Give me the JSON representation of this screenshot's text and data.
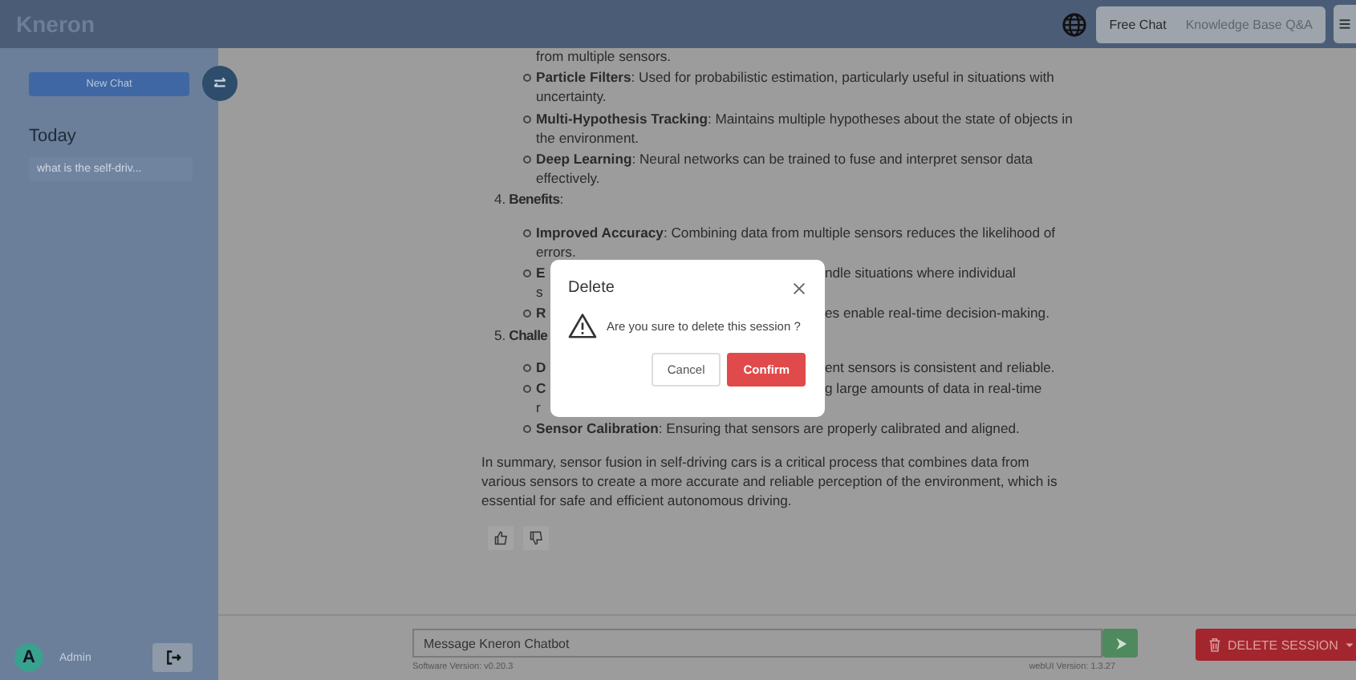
{
  "header": {
    "logo": "Kneron",
    "tabs": [
      {
        "label": "Free Chat",
        "selected": true
      },
      {
        "label": "Knowledge Base Q&A",
        "selected": false
      }
    ]
  },
  "sidebar": {
    "new_chat": "New Chat",
    "section": "Today",
    "items": [
      {
        "label": "what is the self-driv...",
        "selected": false
      }
    ],
    "user": {
      "initial": "A",
      "name": "Admin"
    }
  },
  "message": {
    "blocks": [
      {
        "kind": "text",
        "text": "from multiple sensors."
      },
      {
        "kind": "bullet",
        "text": "**Particle Filters**: Used for probabilistic estimation, particularly useful in situations with uncertainty."
      },
      {
        "kind": "bullet",
        "text": "**Multi-Hypothesis Tracking**: Maintains multiple hypotheses about the state of objects in the environment."
      },
      {
        "kind": "bullet",
        "text": "**Deep Learning**: Neural networks can be trained to fuse and interpret sensor data effectively."
      },
      {
        "kind": "heading",
        "number": "4.",
        "text": "**Benefits**:"
      },
      {
        "kind": "bullet",
        "text": "**Improved Accuracy**: Combining data from multiple sensors reduces the likelihood of errors."
      },
      {
        "kind": "covered",
        "lines": [
          {
            "left": "**E**",
            "right": "ndle situations where individual"
          },
          {
            "left": "s"
          }
        ]
      },
      {
        "kind": "covered",
        "lines": [
          {
            "left": "**R**",
            "right": "es enable real-time decision-making."
          }
        ]
      },
      {
        "kind": "heading",
        "number": "5.",
        "text": "**Challe**"
      },
      {
        "kind": "covered",
        "lines": [
          {
            "left": "**D**",
            "right": "ent sensors is consistent and reliable."
          }
        ]
      },
      {
        "kind": "covered",
        "lines": [
          {
            "left": "**C**",
            "right": "g large amounts of data in real-time"
          },
          {
            "left": "r"
          }
        ]
      },
      {
        "kind": "bullet",
        "text": "**Sensor Calibration**: Ensuring that sensors are properly calibrated and aligned."
      },
      {
        "kind": "paragraph",
        "text": "In summary, sensor fusion in self-driving cars is a critical process that combines data from various sensors to create a more accurate and reliable perception of the environment, which is essential for safe and efficient autonomous driving."
      }
    ]
  },
  "composer": {
    "placeholder": "Message Kneron Chatbot",
    "software_version": "Software Version: v0.20.3",
    "webui_version": "webUI Version: 1.3.27"
  },
  "delete_session": "DELETE SESSION",
  "dialog": {
    "title": "Delete",
    "message": "Are you sure to delete this session ?",
    "buttons": [
      {
        "label": "Cancel",
        "kind": "secondary"
      },
      {
        "label": "Confirm",
        "kind": "primary"
      }
    ]
  }
}
